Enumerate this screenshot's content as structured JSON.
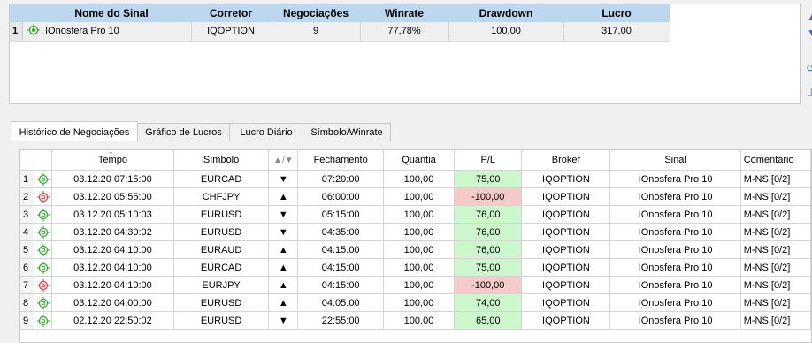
{
  "signals": {
    "columns": [
      "Nome do Sinal",
      "Corretor",
      "Negociações",
      "Winrate",
      "Drawdown",
      "Lucro"
    ],
    "rows": [
      {
        "index": "1",
        "name": "IOnosfera Pro 10",
        "broker": "IQOPTION",
        "trades": "9",
        "winrate": "77,78%",
        "drawdown": "100,00",
        "profit": "317,00"
      }
    ]
  },
  "tabs": [
    "Histórico de Negociações",
    "Gráfico de Lucros",
    "Lucro Diário",
    "Símbolo/Winrate"
  ],
  "active_tab": 0,
  "history": {
    "columns": [
      "Tempo",
      "Símbolo",
      "▲/▼",
      "Fechamento",
      "Quantia",
      "P/L",
      "Broker",
      "Sinal",
      "Comentário"
    ],
    "rows": [
      {
        "index": "1",
        "status": "win",
        "time": "03.12.20 07:15:00",
        "symbol": "EURCAD",
        "dir": "▼",
        "close": "07:20:00",
        "amount": "100,00",
        "pl": "75,00",
        "broker": "IQOPTION",
        "signal": "IOnosfera Pro 10",
        "comment": "M-NS [0/2]"
      },
      {
        "index": "2",
        "status": "loss",
        "time": "03.12.20 05:55:00",
        "symbol": "CHFJPY",
        "dir": "▲",
        "close": "06:00:00",
        "amount": "100,00",
        "pl": "-100,00",
        "broker": "IQOPTION",
        "signal": "IOnosfera Pro 10",
        "comment": "M-NS [0/2]"
      },
      {
        "index": "3",
        "status": "win",
        "time": "03.12.20 05:10:03",
        "symbol": "EURUSD",
        "dir": "▼",
        "close": "05:15:00",
        "amount": "100,00",
        "pl": "76,00",
        "broker": "IQOPTION",
        "signal": "IOnosfera Pro 10",
        "comment": "M-NS [0/2]"
      },
      {
        "index": "4",
        "status": "win",
        "time": "03.12.20 04:30:02",
        "symbol": "EURUSD",
        "dir": "▼",
        "close": "04:35:00",
        "amount": "100,00",
        "pl": "76,00",
        "broker": "IQOPTION",
        "signal": "IOnosfera Pro 10",
        "comment": "M-NS [0/2]"
      },
      {
        "index": "5",
        "status": "win",
        "time": "03.12.20 04:10:00",
        "symbol": "EURAUD",
        "dir": "▲",
        "close": "04:15:00",
        "amount": "100,00",
        "pl": "76,00",
        "broker": "IQOPTION",
        "signal": "IOnosfera Pro 10",
        "comment": "M-NS [0/2]"
      },
      {
        "index": "6",
        "status": "win",
        "time": "03.12.20 04:10:00",
        "symbol": "EURCAD",
        "dir": "▲",
        "close": "04:15:00",
        "amount": "100,00",
        "pl": "75,00",
        "broker": "IQOPTION",
        "signal": "IOnosfera Pro 10",
        "comment": "M-NS [0/2]"
      },
      {
        "index": "7",
        "status": "loss",
        "time": "03.12.20 04:10:00",
        "symbol": "EURJPY",
        "dir": "▲",
        "close": "04:15:00",
        "amount": "100,00",
        "pl": "-100,00",
        "broker": "IQOPTION",
        "signal": "IOnosfera Pro 10",
        "comment": "M-NS [0/2]"
      },
      {
        "index": "8",
        "status": "win",
        "time": "03.12.20 04:00:00",
        "symbol": "EURUSD",
        "dir": "▲",
        "close": "04:05:00",
        "amount": "100,00",
        "pl": "74,00",
        "broker": "IQOPTION",
        "signal": "IOnosfera Pro 10",
        "comment": "M-NS [0/2]"
      },
      {
        "index": "9",
        "status": "win",
        "time": "02.12.20 22:50:02",
        "symbol": "EURUSD",
        "dir": "▼",
        "close": "22:55:00",
        "amount": "100,00",
        "pl": "65,00",
        "broker": "IQOPTION",
        "signal": "IOnosfera Pro 10",
        "comment": "M-NS [0/2]"
      }
    ]
  },
  "colors": {
    "header_blue": "#bcd8f0",
    "profit_green": "#ccf6cc",
    "loss_red": "#f7caca",
    "win_icon": "#27a827",
    "loss_icon": "#d83a3a",
    "side_icon": "#2a6db5"
  },
  "icons": {
    "row_status_win": "target-icon-green",
    "row_status_loss": "target-icon-red",
    "side_toolbar": [
      "chevron-up-icon",
      "chevron-down-icon",
      "refresh-icon",
      "trash-icon"
    ]
  }
}
